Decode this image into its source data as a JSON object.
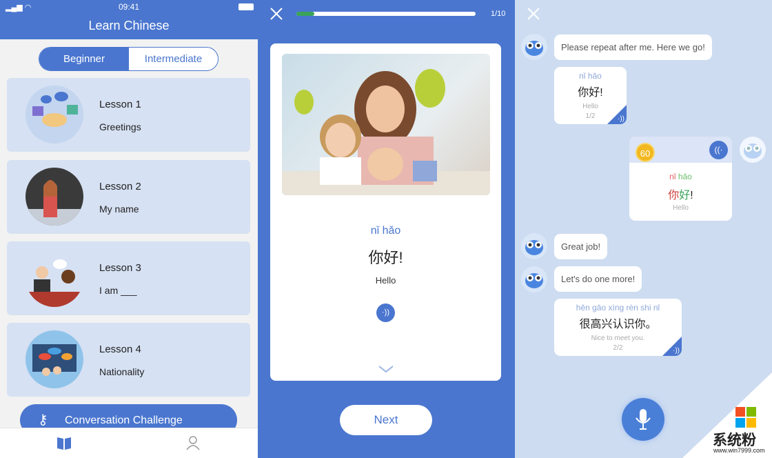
{
  "lessons_screen": {
    "status": {
      "time": "09:41"
    },
    "title": "Learn Chinese",
    "levels": [
      "Beginner",
      "Intermediate"
    ],
    "selected_level": "Beginner",
    "lessons": [
      {
        "title": "Lesson 1",
        "subtitle": "Greetings"
      },
      {
        "title": "Lesson 2",
        "subtitle": "My name"
      },
      {
        "title": "Lesson 3",
        "subtitle": "I am ___"
      },
      {
        "title": "Lesson 4",
        "subtitle": "Nationality"
      }
    ],
    "challenge_label": "Conversation Challenge",
    "tabs": [
      "book-icon",
      "profile-icon"
    ]
  },
  "flashcard_screen": {
    "progress": {
      "current": 1,
      "total": 10,
      "label": "1/10",
      "fraction": 0.1
    },
    "pinyin": "nǐ hǎo",
    "hanzi": "你好!",
    "translation": "Hello",
    "next_label": "Next",
    "accent_color": "#4a76cf",
    "progress_color": "#3aa35a"
  },
  "chat_screen": {
    "messages": [
      {
        "from": "bot",
        "text": "Please repeat after me. Here we go!"
      },
      {
        "from": "bot",
        "card": {
          "pinyin": "nǐ hǎo",
          "hanzi": "你好!",
          "translation": "Hello",
          "count": "1/2"
        }
      },
      {
        "from": "user",
        "card": {
          "score": "60",
          "pinyin_a": "nǐ",
          "pinyin_b": "hǎo",
          "hanzi_a": "你",
          "hanzi_b": "好",
          "hanzi_c": "!",
          "translation": "Hello"
        }
      },
      {
        "from": "bot",
        "text": "Great job!"
      },
      {
        "from": "bot",
        "text": "Let's do one more!"
      },
      {
        "from": "bot",
        "card": {
          "pinyin": "hěn gāo xìng rèn shi nǐ",
          "hanzi": "很高兴认识你。",
          "translation": "Nice to meet you.",
          "count": "2/2"
        }
      }
    ],
    "mic": "microphone-icon"
  },
  "watermark": {
    "text": "系统粉",
    "url": "www.win7999.com"
  }
}
